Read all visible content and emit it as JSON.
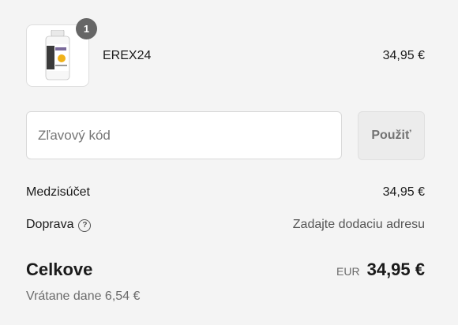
{
  "line_item": {
    "quantity": "1",
    "name": "EREX24",
    "price": "34,95 €",
    "image_icon": "product-bottle-image"
  },
  "discount": {
    "placeholder": "Zľavový kód",
    "apply_label": "Použiť"
  },
  "summary": {
    "subtotal_label": "Medzisúčet",
    "subtotal_value": "34,95 €",
    "shipping_label": "Doprava",
    "shipping_help_icon": "?",
    "shipping_value": "Zadajte dodaciu adresu",
    "total_label": "Celkove",
    "currency": "EUR",
    "total_value": "34,95 €",
    "taxes_note": "Vrátane dane 6,54 €"
  },
  "colors": {
    "background": "#f4f4f4",
    "badge": "#666666",
    "button_bg": "#ececec"
  }
}
